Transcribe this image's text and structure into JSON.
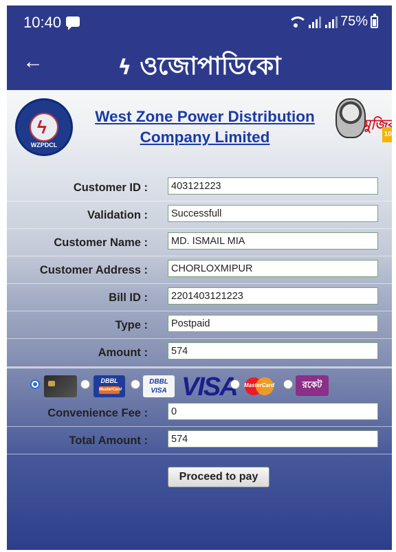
{
  "status_bar": {
    "time": "10:40",
    "battery": "75%"
  },
  "app_bar": {
    "title": "ওজোপাডিকো"
  },
  "organization": {
    "name": "West Zone Power Distribution Company Limited",
    "logo_text": "WZPDCL",
    "campaign_logo_text": "মুজিব"
  },
  "form": {
    "customer_id": {
      "label": "Customer ID :",
      "value": "403121223"
    },
    "validation": {
      "label": "Validation :",
      "value": "Successfull"
    },
    "customer_name": {
      "label": "Customer Name :",
      "value": "MD. ISMAIL MIA"
    },
    "customer_address": {
      "label": "Customer Address :",
      "value": "CHORLOXMIPUR"
    },
    "bill_id": {
      "label": "Bill ID :",
      "value": "2201403121223"
    },
    "type": {
      "label": "Type :",
      "value": "Postpaid"
    },
    "amount": {
      "label": "Amount :",
      "value": "574"
    },
    "convenience_fee": {
      "label": "Convenience Fee :",
      "value": "0"
    },
    "total_amount": {
      "label": "Total Amount :",
      "value": "574"
    }
  },
  "payment_methods": {
    "selected": "bkash-card",
    "dbbl_nexus": "DBBL",
    "dbbl_mastercard_text": "MasterCard",
    "dbbl_visa": "DBBL VISA",
    "visa": "VISA",
    "mastercard": "MasterCard",
    "rocket": "রকেট"
  },
  "actions": {
    "proceed_label": "Proceed to pay"
  }
}
